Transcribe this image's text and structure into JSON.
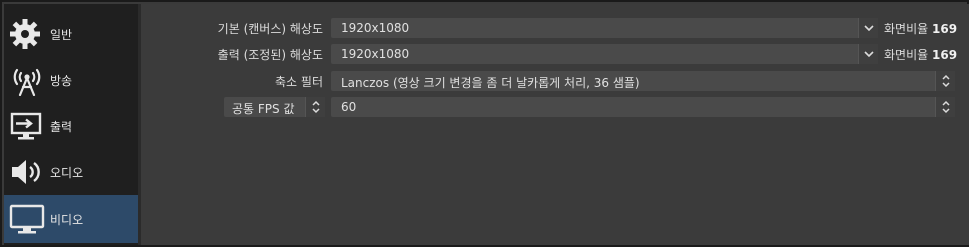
{
  "sidebar": {
    "items": [
      {
        "label": "일반",
        "icon": "gear-icon"
      },
      {
        "label": "방송",
        "icon": "broadcast-antenna-icon"
      },
      {
        "label": "출력",
        "icon": "output-monitor-icon"
      },
      {
        "label": "오디오",
        "icon": "speaker-icon"
      },
      {
        "label": "비디오",
        "icon": "monitor-icon",
        "active": true
      }
    ]
  },
  "video": {
    "base_resolution": {
      "label": "기본 (캔버스) 해상도",
      "value": "1920x1080",
      "aspect_prefix": "화면비율",
      "aspect_value": "169"
    },
    "output_resolution": {
      "label": "출력 (조정된) 해상도",
      "value": "1920x1080",
      "aspect_prefix": "화면비율",
      "aspect_value": "169"
    },
    "downscale_filter": {
      "label": "축소 필터",
      "value": "Lanczos (영상 크기 변경을 좀 더 날카롭게 처리, 36 샘플)"
    },
    "fps": {
      "label": "공통 FPS 값",
      "value": "60"
    }
  },
  "colors": {
    "active_item": "#2d4a69",
    "sidebar_bg": "#1f1f1f",
    "content_bg": "#3b3b3b",
    "input_bg": "#4a4a4a"
  }
}
